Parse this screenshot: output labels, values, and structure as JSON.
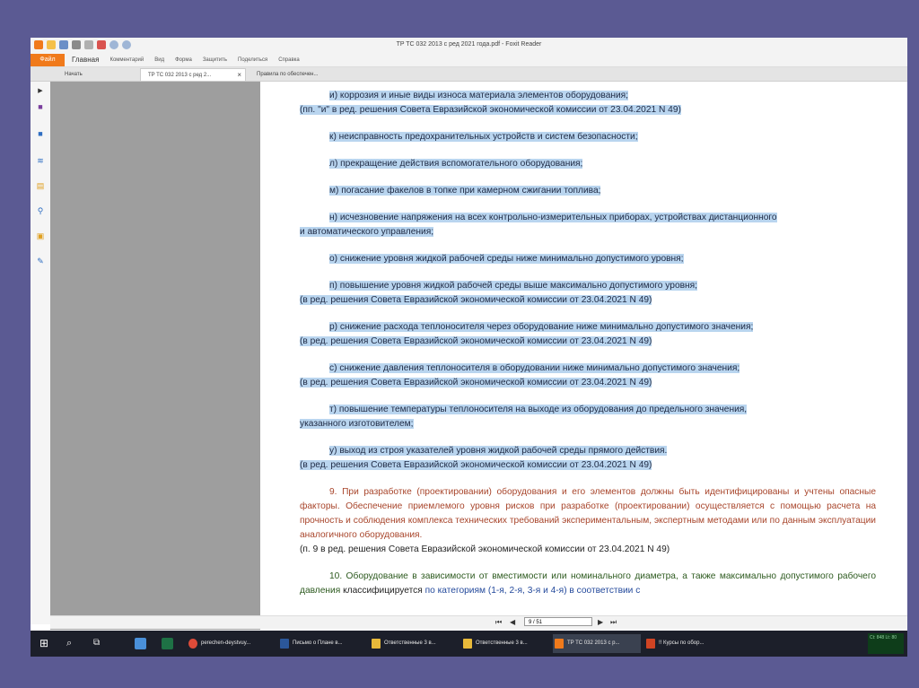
{
  "window": {
    "title": "TP TC 032 2013 с ред 2021 года.pdf - Foxit Reader"
  },
  "ribbon": {
    "file": "Файл",
    "items": [
      "Главная",
      "Комментарий",
      "Вид",
      "Форма",
      "Защитить",
      "Поделиться",
      "Справка"
    ]
  },
  "tabs": [
    {
      "label": "Начать"
    },
    {
      "label": "TP TC 032 2013 с ред 2...",
      "active": true
    },
    {
      "label": "Правила по обеспечен..."
    }
  ],
  "document": {
    "paragraphs": [
      {
        "lines": [
          "и) коррозия и иные виды износа материала элементов оборудования;",
          "(пп. \"и\" в ред. решения Совета Евразийской экономической комиссии от 23.04.2021 N 49)"
        ]
      },
      {
        "lines": [
          "к) неисправность предохранительных устройств и систем безопасности;"
        ]
      },
      {
        "lines": [
          "л) прекращение действия вспомогательного оборудования;"
        ]
      },
      {
        "lines": [
          "м) погасание факелов в топке при камерном сжигании топлива;"
        ]
      },
      {
        "lines": [
          "н) исчезновение напряжения на всех контрольно-измерительных приборах, устройствах дистанционного",
          "и автоматического управления;"
        ]
      },
      {
        "lines": [
          "о) снижение уровня жидкой рабочей среды ниже минимально допустимого уровня;"
        ]
      },
      {
        "lines": [
          "п) повышение уровня жидкой рабочей среды выше максимально допустимого уровня;",
          "(в ред. решения Совета Евразийской экономической комиссии от 23.04.2021 N 49)"
        ]
      },
      {
        "lines": [
          "р) снижение расхода теплоносителя через оборудование ниже минимально допустимого значения;",
          "(в ред. решения Совета Евразийской экономической комиссии от 23.04.2021 N 49)"
        ]
      },
      {
        "lines": [
          "с) снижение давления теплоносителя в оборудовании ниже минимально допустимого значения;",
          "(в ред. решения Совета Евразийской экономической комиссии от 23.04.2021 N 49)"
        ]
      },
      {
        "lines": [
          "т) повышение температуры теплоносителя на выходе из оборудования до предельного значения,",
          "указанного изготовителем;"
        ]
      },
      {
        "lines": [
          "у) выход из строя указателей уровня жидкой рабочей среды прямого действия.",
          "(в ред. решения Совета Евразийской экономической комиссии от 23.04.2021 N 49)"
        ]
      }
    ],
    "p9": {
      "text": "9. При разработке (проектировании) оборудования и его элементов должны быть идентифицированы и учтены опасные факторы. Обеспечение приемлемого уровня рисков при разработке (проектировании) осуществляется с помощью расчета на прочность и соблюдения комплекса технических требований экспериментальным, экспертным методами или по данным эксплуатации аналогичного оборудования.",
      "note": "(п. 9 в ред. решения Совета Евразийской экономической комиссии от 23.04.2021 N 49)"
    },
    "p10": {
      "part1": "10. Оборудование в зависимости от вместимости или номинального диаметра, а также максимально допустимого рабочего давления",
      "part2": "классифицируется",
      "part3": "по категориям (1-я, 2-я, 3-я и 4-я) в соответствии с"
    }
  },
  "navigation": {
    "page": "9 / 51"
  },
  "taskbar": {
    "items": [
      {
        "label": "perechen-deystvuy...",
        "color": "#dd4b39"
      },
      {
        "label": "Письмо о Плане в...",
        "color": "#2b579a"
      },
      {
        "label": "Ответственные 3 в...",
        "color": "#e8b93a"
      },
      {
        "label": "Ответственные 3 в...",
        "color": "#e8b93a"
      },
      {
        "label": "TP TC 032 2013 с р...",
        "color": "#f07a1b",
        "active": true
      },
      {
        "label": "!! Курсы по обор...",
        "color": "#d04423"
      }
    ],
    "tray": "Ct: 848 Lt: 80"
  },
  "colors": {
    "accent": "#f07a1b",
    "highlight": "#b9d5ef",
    "desk": "#5b5a93"
  }
}
